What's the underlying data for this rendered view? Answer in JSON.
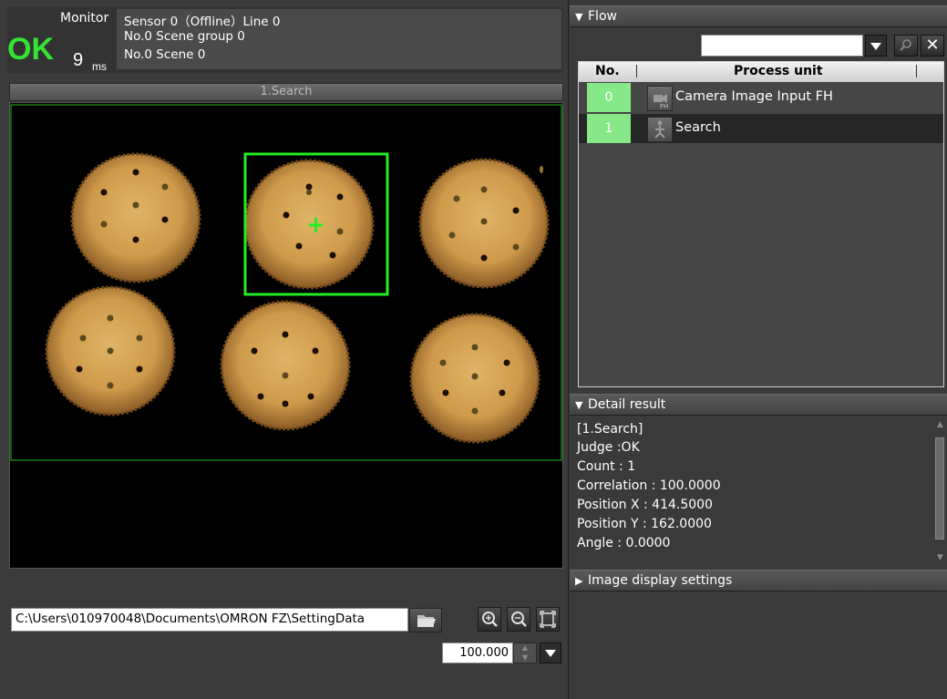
{
  "monitor": {
    "label": "Monitor",
    "judge": "OK",
    "time_value": "9",
    "time_unit": "ms",
    "info_lines": [
      "Sensor 0（Offline）Line 0",
      "No.0 Scene group 0",
      "No.0 Scene 0"
    ]
  },
  "image_panel": {
    "title": "1.Search"
  },
  "file": {
    "path": "C:\\Users\\010970048\\Documents\\OMRON FZ\\SettingData"
  },
  "zoom": {
    "value": "100.000"
  },
  "flow": {
    "header": "Flow",
    "columns": [
      "No.",
      "Process unit"
    ],
    "rows": [
      {
        "no": "0",
        "name": "Camera Image Input FH",
        "icon": "camera-fh-icon"
      },
      {
        "no": "1",
        "name": "Search",
        "icon": "search-unit-icon"
      }
    ]
  },
  "detail": {
    "header": "Detail result",
    "lines": [
      "[1.Search]",
      "Judge :OK",
      "Count : 1",
      "Correlation : 100.0000",
      "Position X : 414.5000",
      "Position Y : 162.0000",
      "Angle : 0.0000"
    ]
  },
  "image_display": {
    "header": "Image display settings"
  },
  "colors": {
    "ok_green": "#34e434",
    "row_number_green": "#87e887",
    "search_box": "#22ee22"
  }
}
